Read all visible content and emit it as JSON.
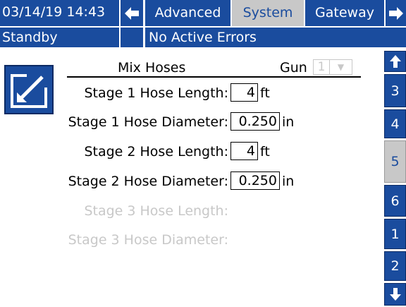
{
  "topbar": {
    "datetime": "03/14/19 14:43",
    "tabs": [
      {
        "label": "Advanced"
      },
      {
        "label": "System"
      },
      {
        "label": "Gateway"
      }
    ]
  },
  "statusbar": {
    "mode": "Standby",
    "errors": "No Active Errors"
  },
  "section": {
    "title": "Mix Hoses",
    "gun_label": "Gun",
    "gun_value": "1"
  },
  "fields": [
    {
      "label": "Stage 1 Hose Length:",
      "value": "4",
      "unit": "ft"
    },
    {
      "label": "Stage 1 Hose Diameter:",
      "value": "0.250",
      "unit": "in"
    },
    {
      "label": "Stage 2 Hose Length:",
      "value": "4",
      "unit": "ft"
    },
    {
      "label": "Stage 2 Hose Diameter:",
      "value": "0.250",
      "unit": "in"
    },
    {
      "label": "Stage 3 Hose Length:"
    },
    {
      "label": "Stage 3 Hose Diameter:"
    }
  ],
  "sidebar": {
    "pages": [
      "3",
      "4",
      "5",
      "6",
      "1",
      "2"
    ],
    "selected": "5"
  },
  "colors": {
    "accent": "#1a4c9e",
    "selected": "#c8c8c8",
    "disabled_text": "#c8c8c8"
  }
}
